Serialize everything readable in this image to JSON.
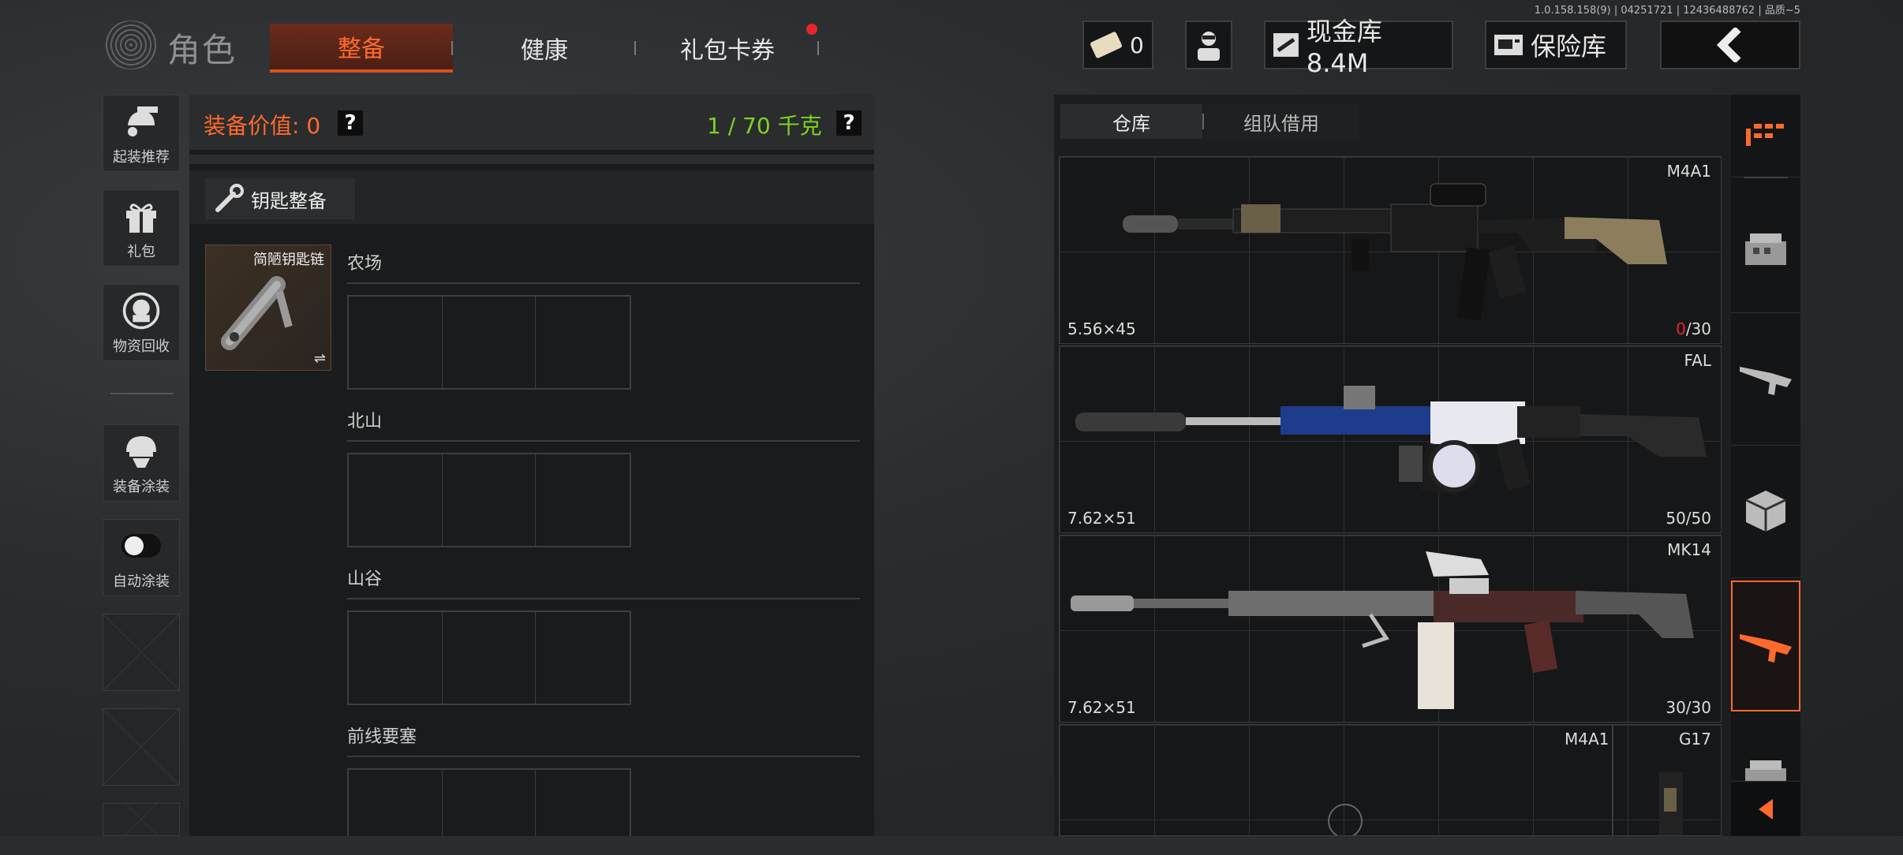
{
  "version": "1.0.158.158(9) | 04251721 | 12436488762 | 品质~5",
  "header": {
    "title": "角色",
    "tabs": [
      {
        "label": "整备",
        "active": true
      },
      {
        "label": "健康",
        "active": false
      },
      {
        "label": "礼包卡券",
        "active": false,
        "notification": true
      }
    ],
    "ticket_count": "0",
    "cash_vault": "现金库 8.4M",
    "safe_vault": "保险库"
  },
  "sidebar": {
    "items": [
      {
        "label": "起装推荐",
        "icon": "loadout-icon"
      },
      {
        "label": "礼包",
        "icon": "gift-icon"
      },
      {
        "label": "物资回收",
        "icon": "recycle-icon"
      },
      {
        "label": "装备涂装",
        "icon": "helmet-icon"
      },
      {
        "label": "自动涂装",
        "icon": "toggle-icon",
        "toggle_on": false
      }
    ]
  },
  "loadout": {
    "value_label": "装备价值: 0",
    "weight_label": "1 / 70 千克",
    "help": "?",
    "key_button": "钥匙整备",
    "keychain_name": "简陋钥匙链",
    "zones": [
      {
        "name": "农场"
      },
      {
        "name": "北山"
      },
      {
        "name": "山谷"
      },
      {
        "name": "前线要塞"
      }
    ]
  },
  "warehouse": {
    "tabs": [
      {
        "label": "仓库",
        "active": true
      },
      {
        "label": "组队借用",
        "active": false
      }
    ],
    "weapons": [
      {
        "name": "M4A1",
        "caliber": "5.56×45",
        "ammo_current": "0",
        "ammo_max": "/30"
      },
      {
        "name": "FAL",
        "caliber": "7.62×51",
        "ammo": "50/50"
      },
      {
        "name": "MK14",
        "caliber": "7.62×51",
        "ammo": "30/30"
      },
      {
        "name": "M4A1",
        "name2": "G17"
      }
    ]
  },
  "colors": {
    "accent": "#ff6a2c",
    "weight": "#7ed321",
    "alert": "#e8252b"
  }
}
